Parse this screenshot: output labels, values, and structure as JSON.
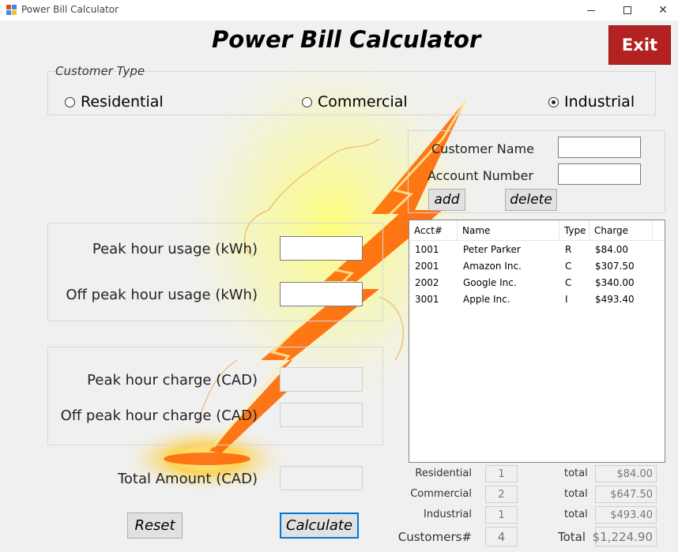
{
  "window": {
    "title": "Power Bill Calculator"
  },
  "header": {
    "title": "Power Bill Calculator",
    "exit_label": "Exit"
  },
  "customer_type": {
    "legend": "Customer Type",
    "options": [
      {
        "label": "Residential",
        "checked": false
      },
      {
        "label": "Commercial",
        "checked": false
      },
      {
        "label": "Industrial",
        "checked": true
      }
    ]
  },
  "customer_form": {
    "name_label": "Customer Name",
    "name_value": "",
    "account_label": "Account Number",
    "account_value": "",
    "add_label": "add",
    "delete_label": "delete"
  },
  "usage": {
    "peak_label": "Peak hour usage (kWh)",
    "peak_value": "",
    "offpeak_label": "Off peak hour usage (kWh)",
    "offpeak_value": ""
  },
  "charges": {
    "peak_label": "Peak hour charge (CAD)",
    "peak_value": "",
    "offpeak_label": "Off peak hour charge (CAD)",
    "offpeak_value": "",
    "total_label": "Total Amount (CAD)",
    "total_value": ""
  },
  "actions": {
    "reset_label": "Reset",
    "calculate_label": "Calculate"
  },
  "table": {
    "columns": [
      "Acct#",
      "Name",
      "Type",
      "Charge"
    ],
    "rows": [
      [
        "1001",
        "Peter Parker",
        "R",
        "$84.00"
      ],
      [
        "2001",
        "Amazon Inc.",
        "C",
        "$307.50"
      ],
      [
        "2002",
        "Google Inc.",
        "C",
        "$340.00"
      ],
      [
        "3001",
        "Apple Inc.",
        "I",
        "$493.40"
      ]
    ]
  },
  "summary": {
    "total_word": "total",
    "rows": [
      {
        "label": "Residential",
        "count": "1",
        "total_label": "total",
        "total": "$84.00"
      },
      {
        "label": "Commercial",
        "count": "2",
        "total_label": "total",
        "total": "$647.50"
      },
      {
        "label": "Industrial",
        "count": "1",
        "total_label": "total",
        "total": "$493.40"
      }
    ],
    "customers_label": "Customers#",
    "customers_count": "4",
    "grand_total_label": "Total",
    "grand_total": "$1,224.90"
  }
}
